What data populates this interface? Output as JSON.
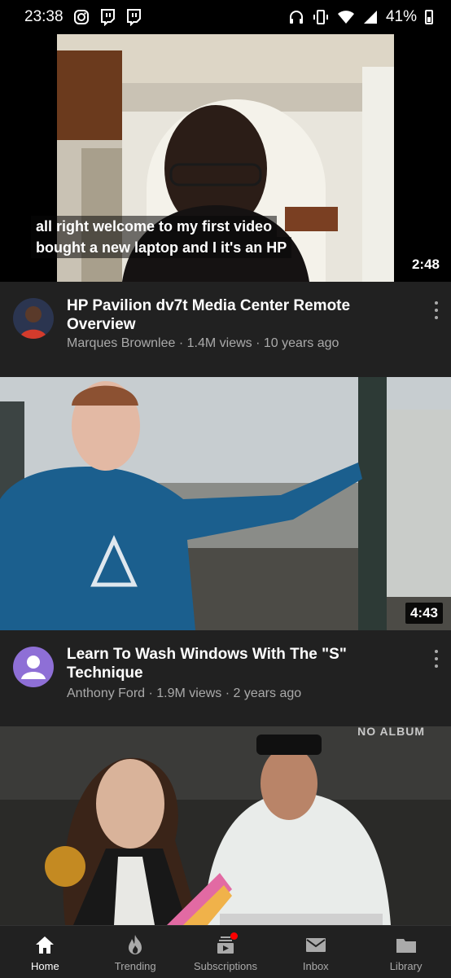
{
  "status_bar": {
    "time": "23:38",
    "battery": "41%"
  },
  "videos": [
    {
      "captions": [
        "all right welcome to my first video",
        "bought a new laptop and I it's an HP"
      ],
      "duration": "2:48",
      "title": "HP Pavilion dv7t Media Center Remote Overview",
      "channel": "Marques Brownlee",
      "views": "1.4M views",
      "age": "10 years ago"
    },
    {
      "duration": "4:43",
      "title": "Learn To Wash Windows With The \"S\" Technique",
      "channel": "Anthony Ford",
      "views": "1.9M views",
      "age": "2 years ago"
    },
    {
      "watermark": "NO ALBUM"
    }
  ],
  "nav": [
    {
      "label": "Home",
      "icon": "home-icon"
    },
    {
      "label": "Trending",
      "icon": "flame-icon"
    },
    {
      "label": "Subscriptions",
      "icon": "subscriptions-icon"
    },
    {
      "label": "Inbox",
      "icon": "mail-icon"
    },
    {
      "label": "Library",
      "icon": "folder-icon"
    }
  ],
  "colors": {
    "background": "#212121",
    "active": "#ffffff",
    "inactive": "#aaaaaa",
    "badge": "#ff0000",
    "avatar_purple": "#8e6fd6"
  }
}
